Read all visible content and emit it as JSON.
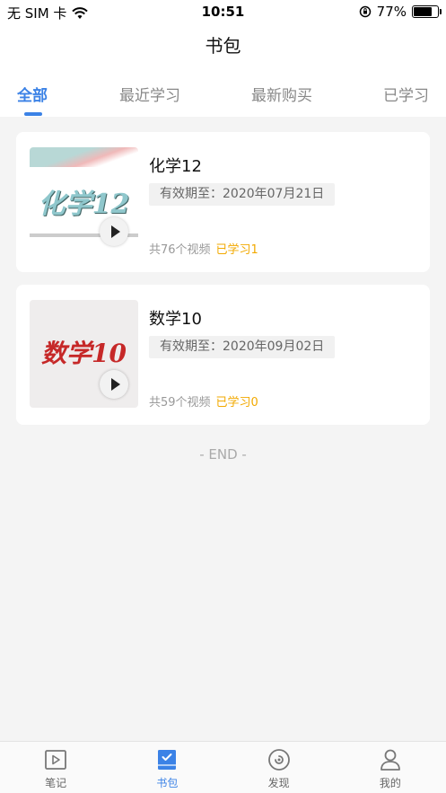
{
  "status_bar": {
    "carrier": "无 SIM 卡",
    "time": "10:51",
    "battery": "77%",
    "battery_level": 0.77,
    "icons": [
      "wifi-icon",
      "orientation-lock-icon",
      "battery-icon"
    ]
  },
  "header": {
    "title": "书包"
  },
  "tabs": [
    {
      "label": "全部",
      "active": true
    },
    {
      "label": "最近学习",
      "active": false
    },
    {
      "label": "最新购买",
      "active": false
    },
    {
      "label": "已学习",
      "active": false
    }
  ],
  "courses": [
    {
      "cover_text": "化学12",
      "title": "化学12",
      "expiry": "有效期至：2020年07月21日",
      "video_count": "共76个视频",
      "progress": "已学习1"
    },
    {
      "cover_text": "数学10",
      "title": "数学10",
      "expiry": "有效期至：2020年09月02日",
      "video_count": "共59个视频",
      "progress": "已学习0"
    }
  ],
  "end_text": "- END -",
  "bottom_nav": [
    {
      "label": "笔记",
      "icon": "video-note-icon",
      "active": false
    },
    {
      "label": "书包",
      "icon": "bookbag-icon",
      "active": true
    },
    {
      "label": "发现",
      "icon": "discover-icon",
      "active": false
    },
    {
      "label": "我的",
      "icon": "profile-icon",
      "active": false
    }
  ],
  "colors": {
    "accent": "#3b82e6",
    "progress": "#f2a900",
    "background": "#f4f4f4"
  }
}
